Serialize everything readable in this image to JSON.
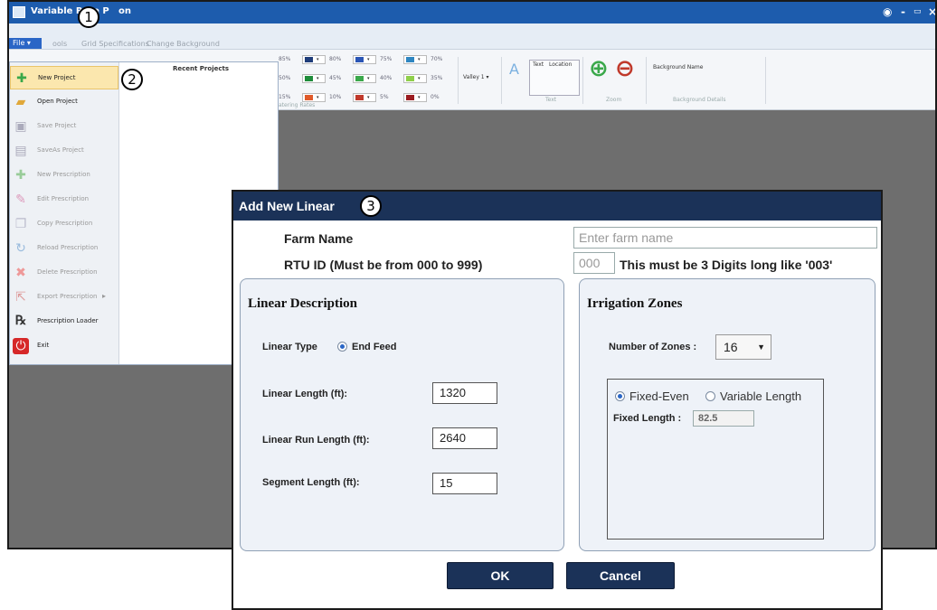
{
  "app": {
    "title": "Variable Rate Prescription",
    "title_visible": "Variable Rate P",
    "title_suffix": "on",
    "window_controls": [
      "◉",
      "-",
      "▭",
      "×"
    ]
  },
  "tabs": {
    "file": "File",
    "items": [
      "Tools",
      "Grid Specifications",
      "Change Background"
    ],
    "tools_visible": "ools"
  },
  "ribbon": {
    "rates_left": [
      "85%",
      "50%",
      "15%"
    ],
    "swatches": [
      {
        "label": "80%",
        "color": "#1f3d7a"
      },
      {
        "label": "75%",
        "color": "#2a55b5"
      },
      {
        "label": "70%",
        "color": "#2e86c1"
      },
      {
        "label": "45%",
        "color": "#1e8c3a"
      },
      {
        "label": "40%",
        "color": "#3aa84a"
      },
      {
        "label": "35%",
        "color": "#8fcf4a"
      },
      {
        "label": "10%",
        "color": "#e05a2a"
      },
      {
        "label": "5%",
        "color": "#c0392b"
      },
      {
        "label": "0%",
        "color": "#9b1c20"
      }
    ],
    "group_rates_label": "atering Rates",
    "valley_label": "Valley 1",
    "text_tab": "Text",
    "location_tab": "Location",
    "text_group": "Text",
    "zoom_group": "Zoom",
    "background_name": "Background Name",
    "background_group": "Background Details"
  },
  "file_menu": {
    "recent_projects": "Recent Projects",
    "items": [
      {
        "label": "New Project",
        "icon": "new-project-icon",
        "enabled": true,
        "active": true
      },
      {
        "label": "Open Project",
        "icon": "open-folder-icon",
        "enabled": true
      },
      {
        "label": "Save Project",
        "icon": "save-icon",
        "enabled": false
      },
      {
        "label": "SaveAs Project",
        "icon": "save-as-icon",
        "enabled": false
      },
      {
        "label": "New Prescription",
        "icon": "new-prescription-icon",
        "enabled": false
      },
      {
        "label": "Edit Prescription",
        "icon": "edit-icon",
        "enabled": false
      },
      {
        "label": "Copy Prescription",
        "icon": "copy-icon",
        "enabled": false
      },
      {
        "label": "Reload Prescription",
        "icon": "reload-icon",
        "enabled": false
      },
      {
        "label": "Delete Prescription",
        "icon": "delete-icon",
        "enabled": false
      },
      {
        "label": "Export Prescription",
        "icon": "export-icon",
        "enabled": false
      },
      {
        "label": "Prescription Loader",
        "icon": "rx-icon",
        "enabled": true
      },
      {
        "label": "Exit",
        "icon": "power-icon",
        "enabled": true
      }
    ],
    "export_arrow": "▸"
  },
  "callouts": [
    "1",
    "2",
    "3"
  ],
  "dialog": {
    "title": "Add New Linear",
    "farm_name_label": "Farm Name",
    "farm_name_placeholder": "Enter farm name",
    "rtu_label": "RTU ID (Must be from 000 to 999)",
    "rtu_placeholder": "000",
    "rtu_hint": "This must be 3 Digits long like '003'",
    "linear_description": {
      "title": "Linear Description",
      "type_label": "Linear Type",
      "type_option": "End Feed",
      "length_label": "Linear Length (ft):",
      "length_value": "1320",
      "run_length_label": "Linear Run Length (ft):",
      "run_length_value": "2640",
      "segment_label": "Segment Length (ft):",
      "segment_value": "15"
    },
    "irrigation_zones": {
      "title": "Irrigation Zones",
      "zones_label": "Number of Zones :",
      "zones_value": "16",
      "option_fixed": "Fixed-Even",
      "option_variable": "Variable Length",
      "fixed_length_label": "Fixed Length :",
      "fixed_length_value": "82.5"
    },
    "ok_label": "OK",
    "cancel_label": "Cancel"
  }
}
